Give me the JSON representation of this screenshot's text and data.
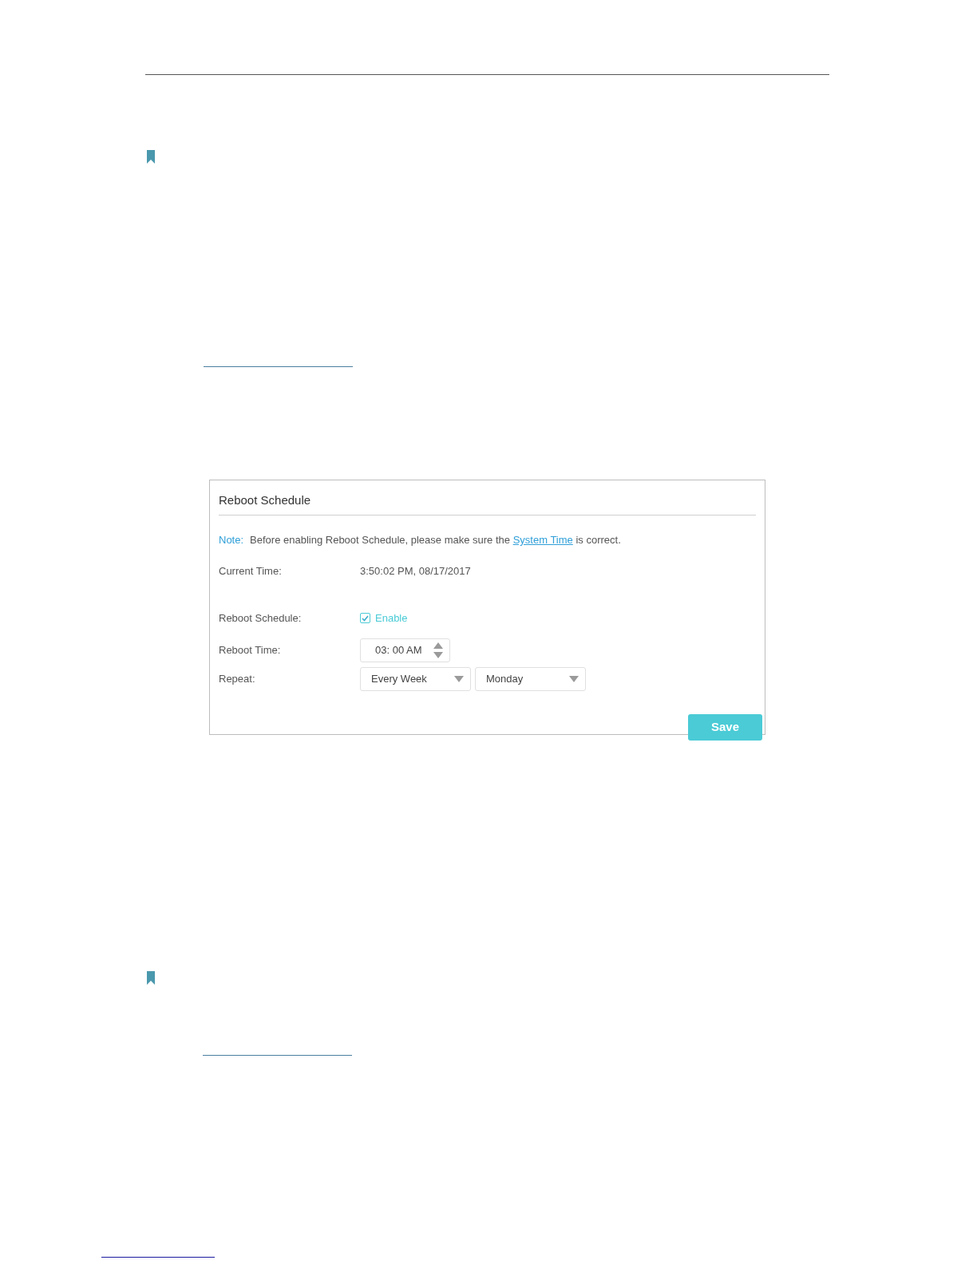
{
  "panel": {
    "title": "Reboot Schedule",
    "note": {
      "label": "Note:",
      "before": "Before enabling Reboot Schedule, please make sure the",
      "link": "System Time",
      "after": "is correct."
    },
    "current_time": {
      "label": "Current Time:",
      "value": "3:50:02 PM, 08/17/2017"
    },
    "reboot_schedule": {
      "label": "Reboot Schedule:",
      "checkbox_label": "Enable",
      "checked": true
    },
    "reboot_time": {
      "label": "Reboot Time:",
      "value": "03: 00 AM"
    },
    "repeat": {
      "label": "Repeat:",
      "selects": [
        "Every Week",
        "Monday"
      ]
    },
    "save_button": "Save"
  }
}
